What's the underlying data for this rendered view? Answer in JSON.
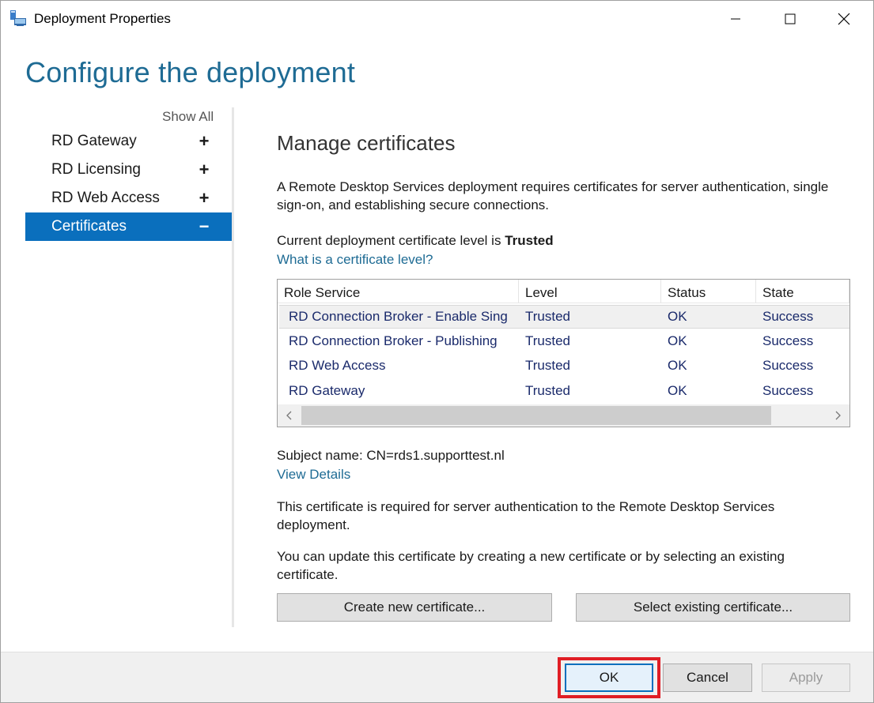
{
  "window": {
    "title": "Deployment Properties",
    "icon": "deployment-icon"
  },
  "page": {
    "heading": "Configure the deployment"
  },
  "nav": {
    "show_all": "Show All",
    "items": [
      {
        "label": "RD Gateway",
        "sign": "+",
        "active": false
      },
      {
        "label": "RD Licensing",
        "sign": "+",
        "active": false
      },
      {
        "label": "RD Web Access",
        "sign": "+",
        "active": false
      },
      {
        "label": "Certificates",
        "sign": "−",
        "active": true
      }
    ]
  },
  "certificates": {
    "title": "Manage certificates",
    "description": "A Remote Desktop Services deployment requires certificates for server authentication, single sign-on, and establishing secure connections.",
    "level_prefix": "Current deployment certificate level is ",
    "level_value": "Trusted",
    "level_link": "What is a certificate level?",
    "table": {
      "columns": [
        "Role Service",
        "Level",
        "Status",
        "State"
      ],
      "rows": [
        [
          "RD Connection Broker - Enable Sing",
          "Trusted",
          "OK",
          "Success"
        ],
        [
          "RD Connection Broker - Publishing",
          "Trusted",
          "OK",
          "Success"
        ],
        [
          "RD Web Access",
          "Trusted",
          "OK",
          "Success"
        ],
        [
          "RD Gateway",
          "Trusted",
          "OK",
          "Success"
        ]
      ],
      "selected_row": 0
    },
    "subject": "Subject name: CN=rds1.supporttest.nl",
    "view_details": "View Details",
    "required_text": "This certificate is required for server authentication to the Remote Desktop Services deployment.",
    "update_text": "You can update this certificate by creating a new certificate or by selecting an existing certificate.",
    "create_button": "Create new certificate...",
    "select_button": "Select existing certificate..."
  },
  "footer": {
    "ok": "OK",
    "cancel": "Cancel",
    "apply": "Apply"
  },
  "colors": {
    "accent": "#0a6fbd",
    "heading": "#1e6b94",
    "highlight": "#e01e25"
  }
}
